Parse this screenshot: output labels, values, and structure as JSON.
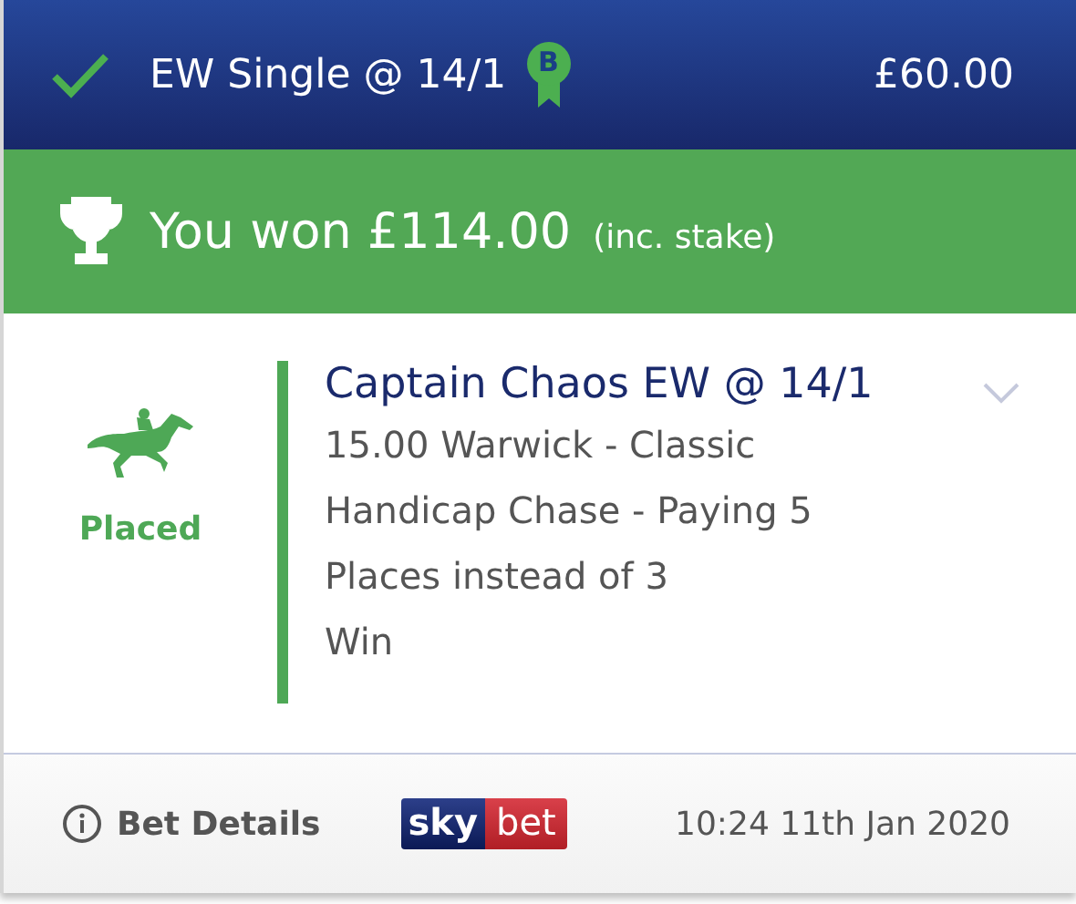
{
  "header": {
    "settled": true,
    "title": "EW Single @ 14/1",
    "badge": "B",
    "stake": "£60.00"
  },
  "result_banner": {
    "text": "You won £114.00",
    "note": "(inc. stake)"
  },
  "legs": [
    {
      "status": "Placed",
      "color": "#4ea856",
      "selection": "Captain Chaos EW @ 14/1",
      "expanded": false,
      "description": "15.00 Warwick - Classic Handicap Chase - Paying 5 Places instead of 3",
      "market": "Win"
    }
  ],
  "footer": {
    "details_link": "Bet Details",
    "logo": {
      "left": "sky",
      "right": "bet"
    },
    "timestamp": "10:24 11th Jan 2020"
  }
}
